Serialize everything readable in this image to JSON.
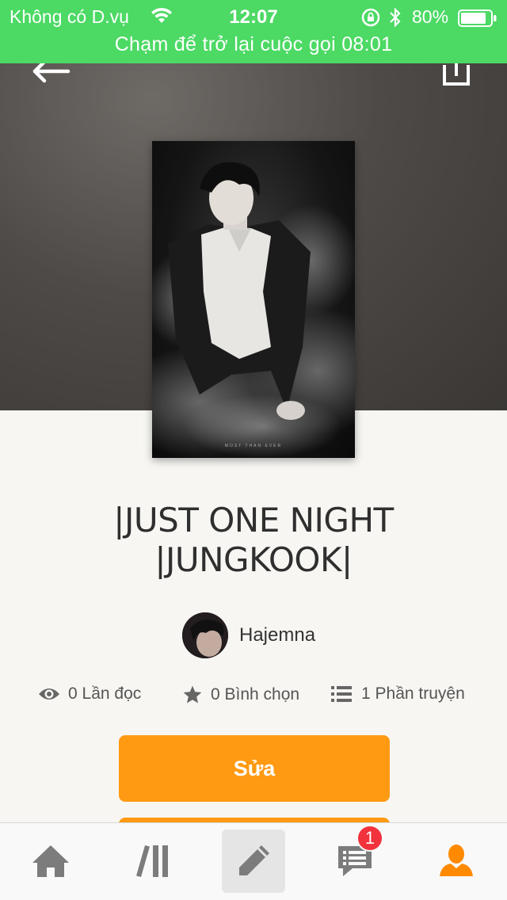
{
  "status_bar": {
    "carrier": "Không có D.vụ",
    "time": "12:07",
    "battery": "80%",
    "call_banner": "Chạm để trở lại cuộc gọi 08:01"
  },
  "story": {
    "title": "|JUST ONE NIGHT |JUNGKOOK|",
    "cover_caption": "MOST THAN EVER"
  },
  "author": {
    "name": "Hajemna"
  },
  "stats": {
    "reads": "0 Lần đọc",
    "votes": "0 Bình chọn",
    "parts": "1 Phần truyện"
  },
  "actions": {
    "edit_label": "Sửa"
  },
  "tab_bar": {
    "notifications_badge": "1",
    "active_tab": "profile",
    "accent_color": "#ff8a00"
  },
  "colors": {
    "status_bar": "#4cd964",
    "primary_button": "#ff9a12",
    "badge": "#f2323c"
  }
}
